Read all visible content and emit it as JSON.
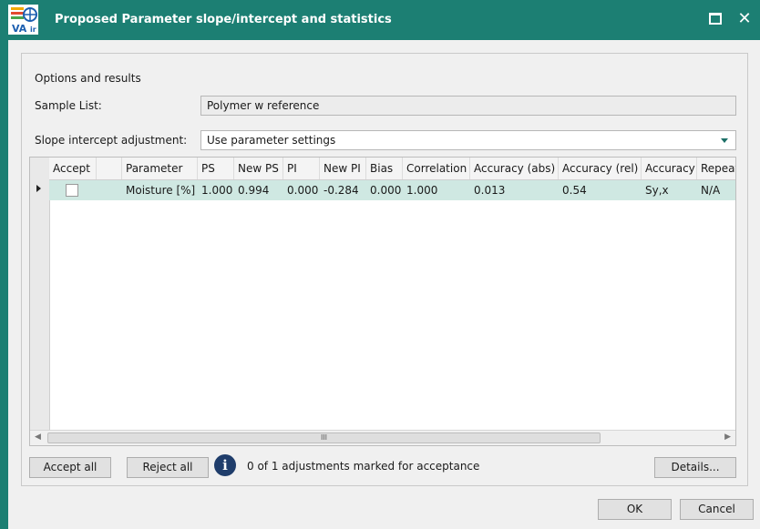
{
  "window": {
    "title": "Proposed Parameter slope/intercept and statistics",
    "maximize_glyph": "maximize-icon",
    "close_glyph": "✕",
    "accent_color": "#1c7f73"
  },
  "panel": {
    "section_title": "Options and results",
    "sample_list_label": "Sample List:",
    "sample_list_value": "Polymer w reference",
    "slope_label": "Slope intercept adjustment:",
    "slope_value": "Use parameter settings"
  },
  "grid": {
    "columns": [
      "Accept",
      "",
      "Parameter",
      "PS",
      "New PS",
      "PI",
      "New PI",
      "Bias",
      "Correlation",
      "Accuracy (abs)",
      "Accuracy (rel)",
      "Accuracy",
      "Repeat"
    ],
    "rows": [
      {
        "accept": false,
        "parameter": "Moisture [%]",
        "ps": "1.000",
        "new_ps": "0.994",
        "pi": "0.000",
        "new_pi": "-0.284",
        "bias": "0.000",
        "correlation": "1.000",
        "accuracy_abs": "0.013",
        "accuracy_rel": "0.54",
        "accuracy": "Sy,x",
        "repeat": "N/A"
      }
    ],
    "selected_row_color": "#cfe8e2",
    "scroll_thumb_glyph": "III"
  },
  "actions": {
    "accept_all": "Accept all",
    "reject_all": "Reject all",
    "status": "0 of 1 adjustments marked for acceptance",
    "details": "Details...",
    "ok": "OK",
    "cancel": "Cancel"
  }
}
